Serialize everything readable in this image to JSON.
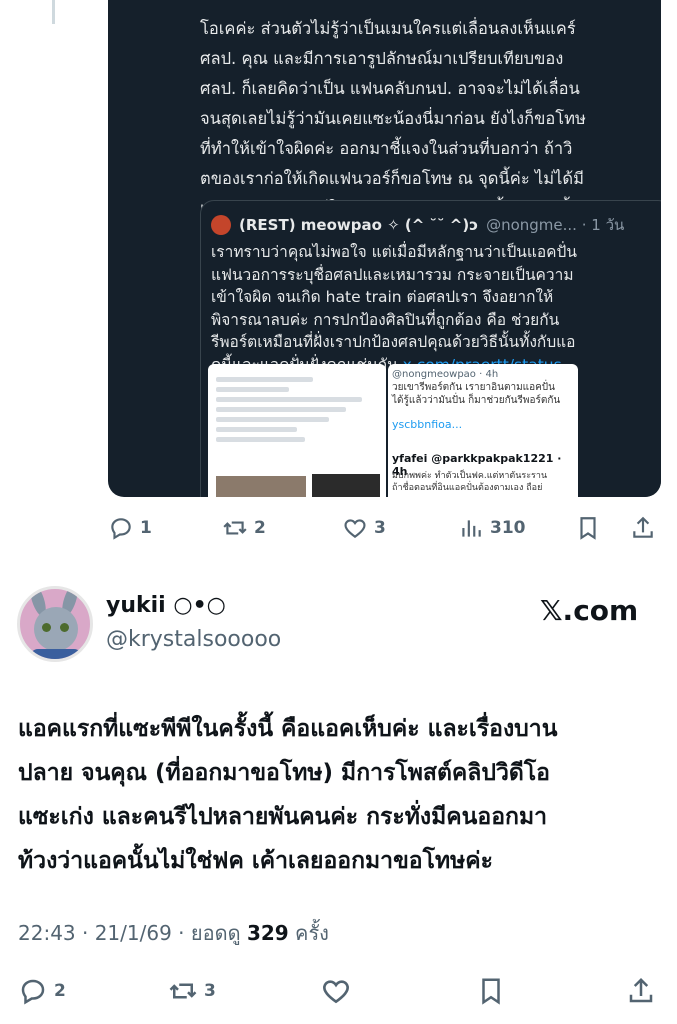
{
  "quoted_shot": {
    "text": "โอเคค่ะ ส่วนตัวไม่รู้ว่าเป็นเมนใครแต่เลื่อนลงเห็นแคร์\nศลป. คุณ และมีการเอารูปลักษณ์มาเปรียบเทียบของ\nศลป. ก็เลยคิดว่าเป็น แฟนคลับกนป. อาจจะไม่ได้เลื่อน\nจนสุดเลยไม่รู้ว่ามันเคยแซะน้องนี่มาก่อน ยังไงก็ขอโทษ\nที่ทำให้เข้าใจผิดค่ะ ออกมาชี้แจงในส่วนที่บอกว่า ถ้าวิ\nตของเราก่อให้เกิดแฟนวอร์ก็ขอโทษ ณ จุดนี้ค่ะ ไม่ได้มี\nเจตนาก่อแฟนวอร์ใด ๆ ค่ะ เราขออนุญาตชี้แจงตรงนี้ค่ะ",
    "inner": {
      "author": "(REST) meowpao ✧ (^ ˘˘ ^)ↄ",
      "handle_time": "@nongme... · 1 วัน",
      "body": "เราทราบว่าคุณไม่พอใจ แต่เมื่อมีหลักฐานว่าเป็นแอคปั่น\nแฟนวอการระบุชื่อศลปและเหมารวม กระจายเป็นความ\nเข้าใจผิด จนเกิด hate train ต่อศลปเรา จึงอยากให้\nพิจารณาลบค่ะ การปกป้องศิลปินที่ถูกต้อง คือ ช่วยกัน\nรีพอร์ตเหมือนที่ฝั่งเราปกป้องศลปคุณด้วยวิธีนั้นทั้งกับแอ\nคนี้และแอคปั่นฝั่งคุณเช่นกัน",
      "link": "x.com/praertt/status..."
    },
    "mini_right": {
      "line1": "@nongmeowpao · 4h",
      "line2": "วยเขารีพอร์ตกัน เรายาอินตามแอคปั่น",
      "line3": "ได้รู้แล้วว่ามันปั่น ก็มาช่วยกันรีพอร์ตกัน",
      "link": "yscbbnfioa...",
      "author": "yfafei @parkkpakpak1221 · 4h",
      "reply": "มบกพพค่ะ ทำตัวเป็นฟค.แต่หาตันระราน\nถ้าชื่อตอนที่อินแอคปั่นต้องตามเอง ถือย่"
    },
    "actions": {
      "reply_count": "1",
      "repost_count": "2",
      "like_count": "3",
      "view_count": "310"
    }
  },
  "tweet": {
    "display_name": "yukii ○•○",
    "handle": "@krystalsooooo",
    "brand": "𝕏.com",
    "text": "แอคแรกที่แซะพีพีในครั้งนี้ คือแอคเห็บค่ะ และเรื่องบาน\nปลาย จนคุณ (ที่ออกมาขอโทษ) มีการโพสต์คลิปวิดีโอ\nแซะเก่ง และคนรีไปหลายพันคนค่ะ กระทั่งมีคนออกมา\nท้วงว่าแอคนั้นไม่ใช่ฟค เค้าเลยออกมาขอโทษค่ะ",
    "time_date": "22:43 · 21/1/69 · ยอดดู ",
    "views": "329",
    "views_suffix": " ครั้ง",
    "actions": {
      "reply_count": "2",
      "repost_count": "3"
    }
  }
}
